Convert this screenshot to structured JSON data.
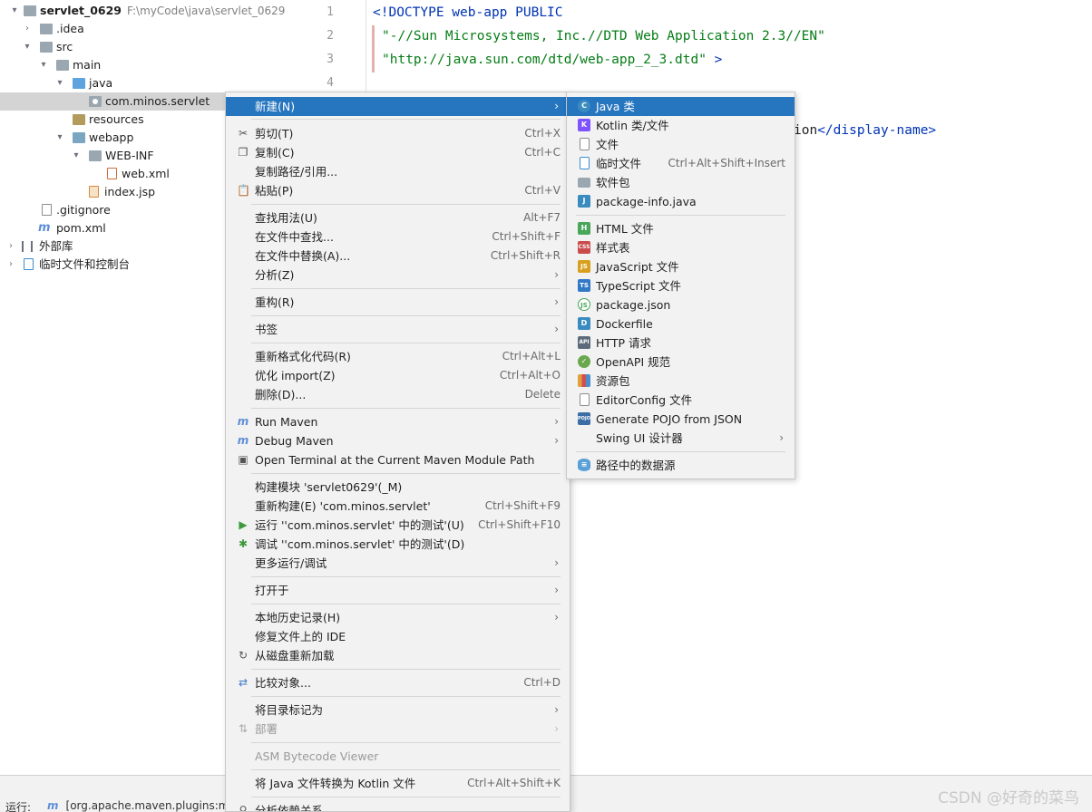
{
  "project_tree": {
    "project_name": "servlet_0629",
    "project_path": "F:\\myCode\\java\\servlet_0629",
    "items": [
      {
        "label": ".idea"
      },
      {
        "label": "src"
      },
      {
        "label": "main"
      },
      {
        "label": "java"
      },
      {
        "label": "com.minos.servlet"
      },
      {
        "label": "resources"
      },
      {
        "label": "webapp"
      },
      {
        "label": "WEB-INF"
      },
      {
        "label": "web.xml"
      },
      {
        "label": "index.jsp"
      },
      {
        "label": ".gitignore"
      },
      {
        "label": "pom.xml"
      },
      {
        "label": "外部库"
      },
      {
        "label": "临时文件和控制台"
      }
    ]
  },
  "editor": {
    "line_numbers": [
      "1",
      "2",
      "3",
      "4"
    ],
    "line1": "<!DOCTYPE web-app PUBLIC",
    "line2": "\"-//Sun Microsystems, Inc.//DTD Web Application 2.3//EN\"",
    "line3_str": "\"http://java.sun.com/dtd/web-app_2_3.dtd\"",
    "line3_end": " >",
    "line6_tail": "ion",
    "line6_tag": "</display-name>"
  },
  "context_menu": {
    "items": [
      {
        "label": "新建(N)",
        "shortcut": "",
        "arrow": "›",
        "icon": ""
      },
      {
        "label": "剪切(T)",
        "shortcut": "Ctrl+X",
        "icon": "✂"
      },
      {
        "label": "复制(C)",
        "shortcut": "Ctrl+C",
        "icon": "❐"
      },
      {
        "label": "复制路径/引用...",
        "shortcut": "",
        "icon": ""
      },
      {
        "label": "粘贴(P)",
        "shortcut": "Ctrl+V",
        "icon": "📋"
      },
      {
        "label": "查找用法(U)",
        "shortcut": "Alt+F7",
        "icon": ""
      },
      {
        "label": "在文件中查找...",
        "shortcut": "Ctrl+Shift+F",
        "icon": ""
      },
      {
        "label": "在文件中替换(A)...",
        "shortcut": "Ctrl+Shift+R",
        "icon": ""
      },
      {
        "label": "分析(Z)",
        "shortcut": "",
        "arrow": "›",
        "icon": ""
      },
      {
        "label": "重构(R)",
        "shortcut": "",
        "arrow": "›",
        "icon": ""
      },
      {
        "label": "书签",
        "shortcut": "",
        "arrow": "›",
        "icon": ""
      },
      {
        "label": "重新格式化代码(R)",
        "shortcut": "Ctrl+Alt+L",
        "icon": ""
      },
      {
        "label": "优化 import(Z)",
        "shortcut": "Ctrl+Alt+O",
        "icon": ""
      },
      {
        "label": "删除(D)...",
        "shortcut": "Delete",
        "icon": ""
      },
      {
        "label": "Run Maven",
        "shortcut": "",
        "arrow": "›",
        "icon": "m"
      },
      {
        "label": "Debug Maven",
        "shortcut": "",
        "arrow": "›",
        "icon": "m"
      },
      {
        "label": "Open Terminal at the Current Maven Module Path",
        "shortcut": "",
        "icon": "▣"
      },
      {
        "label": "构建模块 'servlet0629'(_M)",
        "shortcut": "",
        "icon": ""
      },
      {
        "label": "重新构建(E) 'com.minos.servlet'",
        "shortcut": "Ctrl+Shift+F9",
        "icon": ""
      },
      {
        "label": "运行 ''com.minos.servlet' 中的测试'(U)",
        "shortcut": "Ctrl+Shift+F10",
        "icon": "▶"
      },
      {
        "label": "调试 ''com.minos.servlet' 中的测试'(D)",
        "shortcut": "",
        "icon": "✱"
      },
      {
        "label": "更多运行/调试",
        "shortcut": "",
        "arrow": "›",
        "icon": ""
      },
      {
        "label": "打开于",
        "shortcut": "",
        "arrow": "›",
        "icon": ""
      },
      {
        "label": "本地历史记录(H)",
        "shortcut": "",
        "arrow": "›",
        "icon": ""
      },
      {
        "label": "修复文件上的 IDE",
        "shortcut": "",
        "icon": ""
      },
      {
        "label": "从磁盘重新加载",
        "shortcut": "",
        "icon": "↻"
      },
      {
        "label": "比较对象...",
        "shortcut": "Ctrl+D",
        "icon": "⇄"
      },
      {
        "label": "将目录标记为",
        "shortcut": "",
        "arrow": "›",
        "icon": ""
      },
      {
        "label": "部署",
        "shortcut": "",
        "arrow": "›",
        "icon": "⇅"
      },
      {
        "label": "ASM Bytecode Viewer",
        "shortcut": "",
        "icon": ""
      },
      {
        "label": "将 Java 文件转换为 Kotlin 文件",
        "shortcut": "Ctrl+Alt+Shift+K",
        "icon": ""
      },
      {
        "label": "分析依赖关系...",
        "shortcut": "",
        "icon": "⚲"
      }
    ]
  },
  "submenu": {
    "items": [
      {
        "label": "Java 类",
        "shortcut": "",
        "badge": "C"
      },
      {
        "label": "Kotlin 类/文件",
        "shortcut": "",
        "badge": "K"
      },
      {
        "label": "文件",
        "shortcut": "",
        "badge": ""
      },
      {
        "label": "临时文件",
        "shortcut": "Ctrl+Alt+Shift+Insert",
        "badge": ""
      },
      {
        "label": "软件包",
        "shortcut": "",
        "badge": ""
      },
      {
        "label": "package-info.java",
        "shortcut": "",
        "badge": "J"
      },
      {
        "label": "HTML 文件",
        "shortcut": "",
        "badge": "H"
      },
      {
        "label": "样式表",
        "shortcut": "",
        "badge": "CSS"
      },
      {
        "label": "JavaScript 文件",
        "shortcut": "",
        "badge": "JS"
      },
      {
        "label": "TypeScript 文件",
        "shortcut": "",
        "badge": "TS"
      },
      {
        "label": "package.json",
        "shortcut": "",
        "badge": "JS"
      },
      {
        "label": "Dockerfile",
        "shortcut": "",
        "badge": "D"
      },
      {
        "label": "HTTP 请求",
        "shortcut": "",
        "badge": "API"
      },
      {
        "label": "OpenAPI 规范",
        "shortcut": "",
        "badge": "✓"
      },
      {
        "label": "资源包",
        "shortcut": "",
        "badge": ""
      },
      {
        "label": "EditorConfig 文件",
        "shortcut": "",
        "badge": ""
      },
      {
        "label": "Generate POJO from JSON",
        "shortcut": "",
        "badge": "POJO"
      },
      {
        "label": "Swing UI 设计器",
        "shortcut": "",
        "arrow": "›",
        "badge": ""
      },
      {
        "label": "路径中的数据源",
        "shortcut": "",
        "badge": "≡"
      }
    ]
  },
  "status_bar": {
    "run_label": "运行:",
    "maven_text": "[org.apache.maven.plugins:ma"
  },
  "watermark": "CSDN @好奇的菜鸟",
  "colors": {
    "highlight": "#2675bf",
    "tag": "#0033b3",
    "string": "#067d17",
    "menu_bg": "#f2f2f2"
  }
}
